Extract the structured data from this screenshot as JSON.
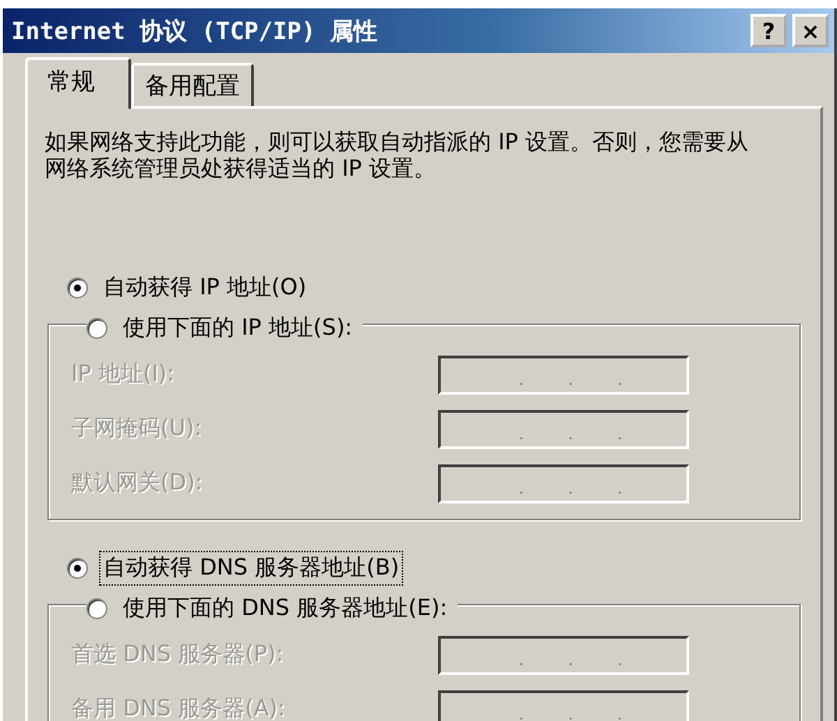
{
  "window": {
    "title": "Internet 协议 (TCP/IP) 属性",
    "buttons": [
      "?",
      "×"
    ]
  },
  "tabs": [
    {
      "label": "常规",
      "selected": true
    },
    {
      "label": "备用配置",
      "selected": false
    }
  ],
  "description": "如果网络支持此功能，则可以获取自动指派的 IP 设置。否则，您需要从网络系统管理员处获得适当的 IP 设置。",
  "sections": [
    {
      "options": [
        {
          "label": "自动获得 IP 地址(O)",
          "selected": true,
          "focused": false
        },
        {
          "label": "使用下面的 IP 地址(S):",
          "selected": false,
          "focused": false
        }
      ],
      "fields": [
        {
          "label": "IP 地址(I):",
          "disabled": true
        },
        {
          "label": "子网掩码(U):",
          "disabled": true
        },
        {
          "label": "默认网关(D):",
          "disabled": true
        }
      ]
    },
    {
      "options": [
        {
          "label": "自动获得 DNS 服务器地址(B)",
          "selected": true,
          "focused": true
        },
        {
          "label": "使用下面的 DNS 服务器地址(E):",
          "selected": false,
          "focused": false
        }
      ],
      "fields": [
        {
          "label": "首选 DNS 服务器(P):",
          "disabled": true
        },
        {
          "label": "备用 DNS 服务器(A):",
          "disabled": true
        }
      ]
    }
  ],
  "ip_separator": "."
}
